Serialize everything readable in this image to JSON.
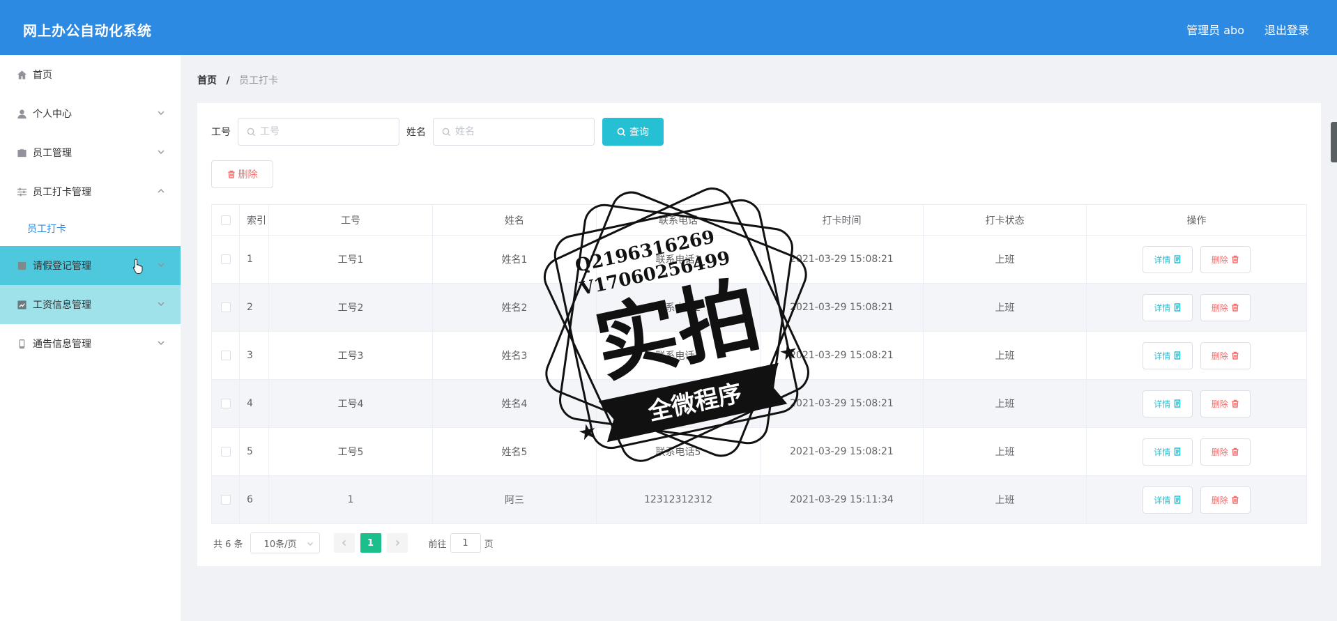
{
  "header": {
    "title": "网上办公自动化系统",
    "user": "管理员 abo",
    "logout": "退出登录"
  },
  "sidebar": {
    "items": [
      {
        "label": "首页"
      },
      {
        "label": "个人中心"
      },
      {
        "label": "员工管理"
      },
      {
        "label": "员工打卡管理"
      },
      {
        "label": "员工打卡"
      },
      {
        "label": "请假登记管理"
      },
      {
        "label": "工资信息管理"
      },
      {
        "label": "通告信息管理"
      }
    ]
  },
  "breadcrumb": {
    "home": "首页",
    "sep": "/",
    "current": "员工打卡"
  },
  "search": {
    "job_label": "工号",
    "job_placeholder": "工号",
    "name_label": "姓名",
    "name_placeholder": "姓名",
    "query_label": "查询"
  },
  "toolbar": {
    "delete_label": "删除"
  },
  "table": {
    "columns": [
      "索引",
      "工号",
      "姓名",
      "联系电话",
      "打卡时间",
      "打卡状态",
      "操作"
    ],
    "rows": [
      {
        "idx": "1",
        "job": "工号1",
        "name": "姓名1",
        "phone": "联系电话1",
        "time": "2021-03-29 15:08:21",
        "status": "上班"
      },
      {
        "idx": "2",
        "job": "工号2",
        "name": "姓名2",
        "phone": "联系电话2",
        "time": "2021-03-29 15:08:21",
        "status": "上班"
      },
      {
        "idx": "3",
        "job": "工号3",
        "name": "姓名3",
        "phone": "联系电话3",
        "time": "2021-03-29 15:08:21",
        "status": "上班"
      },
      {
        "idx": "4",
        "job": "工号4",
        "name": "姓名4",
        "phone": "联系电话4",
        "time": "2021-03-29 15:08:21",
        "status": "上班"
      },
      {
        "idx": "5",
        "job": "工号5",
        "name": "姓名5",
        "phone": "联系电话5",
        "time": "2021-03-29 15:08:21",
        "status": "上班"
      },
      {
        "idx": "6",
        "job": "1",
        "name": "阿三",
        "phone": "12312312312",
        "time": "2021-03-29 15:11:34",
        "status": "上班"
      }
    ],
    "detail_label": "详情",
    "delete_label": "删除"
  },
  "pager": {
    "total": "共 6 条",
    "page_size": "10条/页",
    "current_page": "1",
    "goto_prefix": "前往",
    "goto_value": "1",
    "goto_suffix": "页"
  },
  "stamp": {
    "line1": "Q2196316269",
    "line2": "V17060256499",
    "big": "实拍",
    "banner": "全微程序"
  },
  "colors": {
    "header": "#2d8ae3",
    "accent": "#26c0d4",
    "menu_hover": "#4ec8dd",
    "page_active": "#1cbf8c",
    "danger": "#f56c6c"
  }
}
